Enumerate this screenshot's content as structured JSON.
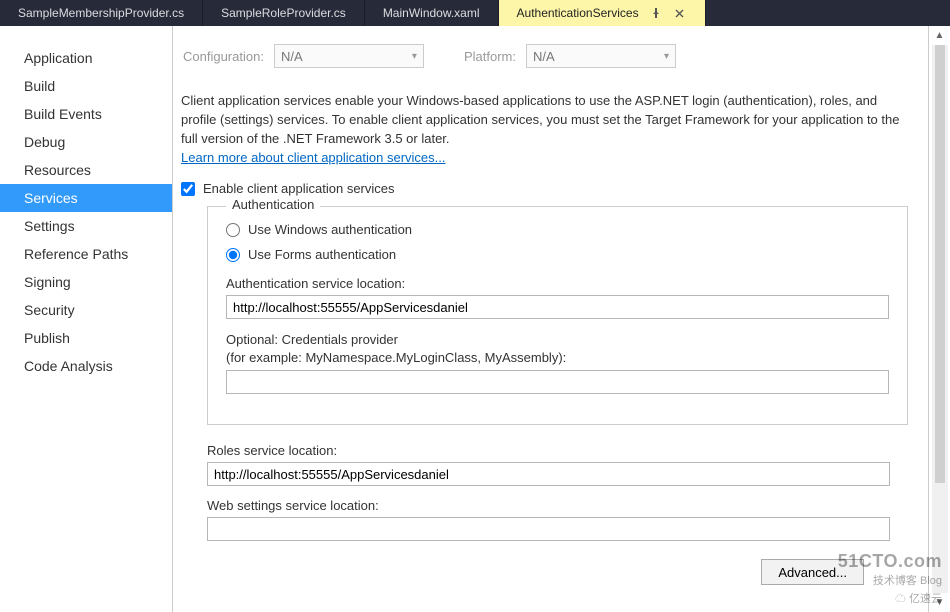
{
  "tabs": [
    {
      "label": "SampleMembershipProvider.cs",
      "active": false
    },
    {
      "label": "SampleRoleProvider.cs",
      "active": false
    },
    {
      "label": "MainWindow.xaml",
      "active": false
    },
    {
      "label": "AuthenticationServices",
      "active": true
    }
  ],
  "sidebar": {
    "items": [
      "Application",
      "Build",
      "Build Events",
      "Debug",
      "Resources",
      "Services",
      "Settings",
      "Reference Paths",
      "Signing",
      "Security",
      "Publish",
      "Code Analysis"
    ],
    "selected_index": 5
  },
  "config": {
    "config_label": "Configuration:",
    "config_value": "N/A",
    "platform_label": "Platform:",
    "platform_value": "N/A"
  },
  "intro": {
    "text": "Client application services enable your Windows-based applications to use the ASP.NET login (authentication), roles, and profile (settings) services. To enable client application services, you must set the Target Framework for your application to the full version of the .NET Framework 3.5 or later.",
    "link": "Learn more about client application services..."
  },
  "enable": {
    "checked": true,
    "label": "Enable client application services"
  },
  "auth": {
    "legend": "Authentication",
    "windows_label": "Use Windows authentication",
    "forms_label": "Use Forms authentication",
    "mode": "forms",
    "service_loc_label": "Authentication service location:",
    "service_loc_value": "http://localhost:55555/AppServicesdaniel",
    "cred_label_1": "Optional: Credentials provider",
    "cred_label_2": "(for example: MyNamespace.MyLoginClass, MyAssembly):",
    "cred_value": ""
  },
  "roles": {
    "label": "Roles service location:",
    "value": "http://localhost:55555/AppServicesdaniel"
  },
  "websettings": {
    "label": "Web settings service location:",
    "value": ""
  },
  "advanced_label": "Advanced...",
  "watermark": {
    "line1": "51CTO.com",
    "line2": "技术博客  Blog",
    "line3": "亿速云"
  }
}
